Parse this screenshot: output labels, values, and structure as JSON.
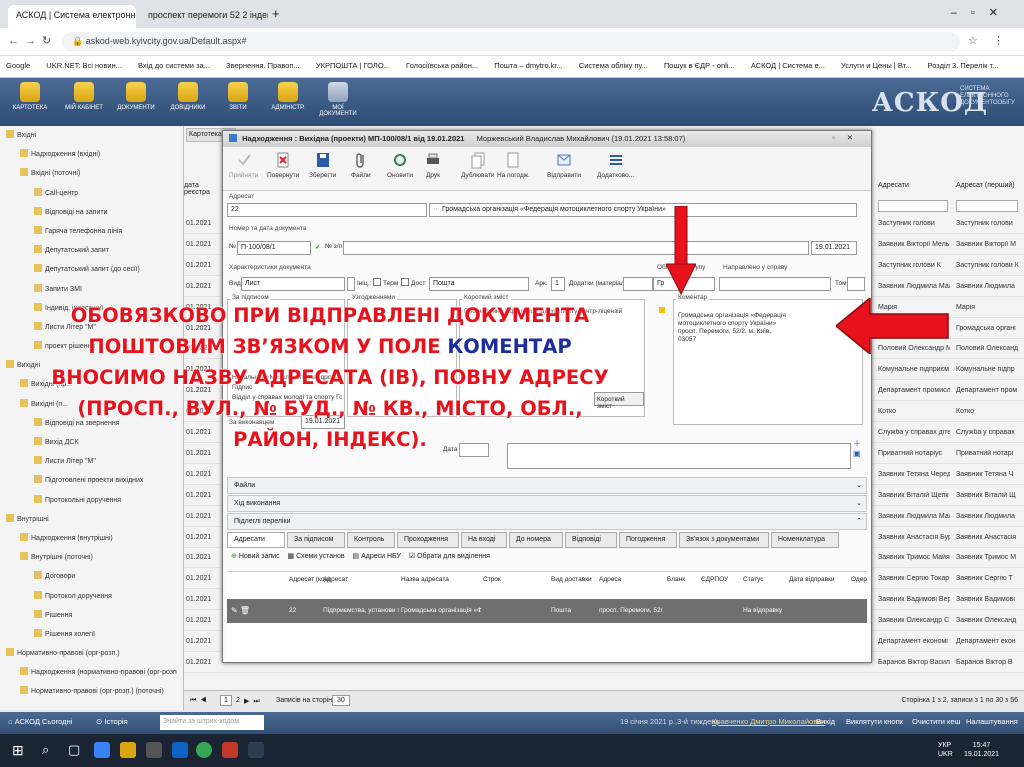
{
  "browser": {
    "tabs": [
      {
        "label": "АСКОД | Система електронног",
        "close": "✕"
      },
      {
        "label": "проспект перемоги 52 2 індекс",
        "close": "✕"
      }
    ],
    "new_tab": "+",
    "url": "askod-web.kyivcity.gov.ua/Default.aspx#",
    "bookmarks": [
      "Google",
      "UKR.NET: Всі новин...",
      "Вхід до системи за...",
      "Звернення. Правоп...",
      "УКРПОШТА | ГОЛО...",
      "Голосіївська район...",
      "Пошта – dmytro.kr...",
      "Система обліку пу...",
      "Пошук в ЄДР - onli...",
      "АСКОД | Система е...",
      "Услуги и Цены | Вт...",
      "Розділ 3. Перелік т..."
    ]
  },
  "app": {
    "toolbar": [
      "КАРТОТЕКА",
      "МІЙ КАБІНЕТ",
      "ДОКУМЕНТИ",
      "ДОВІДНИКИ",
      "ЗВІТИ",
      "АДМІНІСТР.",
      "МОЇ ДОКУМЕНТИ"
    ],
    "logo": "АСКОД",
    "logo_sub": "СИСТЕМА ЕЛЕКТРОННОГО ДОКУМЕНТООБІГУ"
  },
  "tree": [
    {
      "label": "Вхідні",
      "level": 0
    },
    {
      "label": "Надходження (вхідні)",
      "level": 1
    },
    {
      "label": "Вхідні (поточні)",
      "level": 1
    },
    {
      "label": "Call-центр",
      "level": 2
    },
    {
      "label": "Відповіді на запити",
      "level": 2
    },
    {
      "label": "Гаряча телефонна лінія",
      "level": 2
    },
    {
      "label": "Депутатський запит",
      "level": 2
    },
    {
      "label": "Депутатський запит (до сесії)",
      "level": 2
    },
    {
      "label": "Запити ЗМІ",
      "level": 2
    },
    {
      "label": "Індивід. інвестиції",
      "level": 2
    },
    {
      "label": "Листи Літер \"М\"",
      "level": 2
    },
    {
      "label": "проект рішення",
      "level": 2
    },
    {
      "label": "Вихідні",
      "level": 0
    },
    {
      "label": "Вихідні (пр...",
      "level": 1
    },
    {
      "label": "Вихідні (п...",
      "level": 1
    },
    {
      "label": "Відповіді на звернення",
      "level": 2
    },
    {
      "label": "Вихід ДСК",
      "level": 2
    },
    {
      "label": "Листи Літер \"М\"",
      "level": 2
    },
    {
      "label": "Підготовлені проекти вихідних",
      "level": 2
    },
    {
      "label": "Протокольні доручення",
      "level": 2
    },
    {
      "label": "Внутрішні",
      "level": 0
    },
    {
      "label": "Надходження (внутрішні)",
      "level": 1
    },
    {
      "label": "Внутрішні (поточні)",
      "level": 1
    },
    {
      "label": "Договори",
      "level": 2
    },
    {
      "label": "Протокол доручення",
      "level": 2
    },
    {
      "label": "Рішення",
      "level": 2
    },
    {
      "label": "Рішення колегії",
      "level": 2
    },
    {
      "label": "Нормативно-правові (орг-розп.)",
      "level": 0
    },
    {
      "label": "Надходження (нормативно-правові (орг-розп",
      "level": 1
    },
    {
      "label": "Нормативно-правові (орг-розп.) (поточні)",
      "level": 1
    }
  ],
  "bglist": {
    "tab": "Картотека",
    "col_left": "дата реєстра",
    "headers": [
      "Адресати",
      "Адресат (перший)"
    ],
    "dates": [
      "01.2021",
      "01.2021",
      "01.2021",
      "01.2021",
      "01.2021",
      "01.2021",
      "01.2021",
      "01.2021",
      "01.2021",
      "01.2021",
      "01.2021",
      "01.2021",
      "01.2021",
      "01.2021",
      "01.2021",
      "01.2021",
      "01.2021",
      "01.2021",
      "01.2021",
      "01.2021",
      "01.2021",
      "01.2021",
      "01.2021",
      "01.2021",
      "01.2021",
      "01.2021"
    ],
    "rows": [
      [
        "Заступник голови",
        "Заступник голови"
      ],
      [
        "Заявник Вікторії Мель",
        "Заявник Вікторії М"
      ],
      [
        "Заступник голови К",
        "Заступник голови К"
      ],
      [
        "Заявник Людмила Мал",
        "Заявник Людмила"
      ],
      [
        "Марія",
        "Марія"
      ],
      [
        "Громадська організац",
        "Громадська органі"
      ],
      [
        "Половий Олександр М",
        "Половий Олександ"
      ],
      [
        "Комунальне підприєм",
        "Комунальне підпр"
      ],
      [
        "Департамент промисл",
        "Департамент пром"
      ],
      [
        "Котко",
        "Котко"
      ],
      [
        "Служба у справах діте",
        "Служба у справах"
      ],
      [
        "Приватний нотаріус",
        "Приватний нотарі"
      ],
      [
        "Заявник Тетяна Черед",
        "Заявник Тетяна Ч"
      ],
      [
        "Заявник Віталій Щепк",
        "Заявник Віталій Щ"
      ],
      [
        "Заявник Людмила Мал",
        "Заявник Людмила"
      ],
      [
        "Заявник Анастасія Бур",
        "Заявник Анастасія"
      ],
      [
        "Заявник Тримос Майя",
        "Заявник Тримос М"
      ],
      [
        "Заявник Сергію Токар",
        "Заявник Сергію Т"
      ],
      [
        "Заявник Вадимові Вер",
        "Заявник Вадимові"
      ],
      [
        "Заявник Олександр С",
        "Заявник Олександ"
      ],
      [
        "Департамент економі",
        "Департамент екон"
      ],
      [
        "Баранов Віктор Васил",
        "Баранов Віктор В"
      ]
    ]
  },
  "modal": {
    "title": "Надходження : Вихідна (проекти) МП-100/08/1 від 19.01.2021",
    "title_extra": "Моржевський Владислав Михайлович (19.01.2021 13:58:07)",
    "toolbar": [
      "Прийняти",
      "Повернути",
      "Зберегти",
      "Файли",
      "Оновити",
      "Друк",
      "Дублювати",
      "На погодж.",
      "Відправити",
      "Додатково..."
    ],
    "addressee": {
      "label": "Адресат",
      "code": "22",
      "name": "Громадська організація «Федерація мотоциклетного спорту України»"
    },
    "number": {
      "label": "Номер та дата документа",
      "prefix": "№",
      "number": "П-100/08/1",
      "checkbox": "№ з/п",
      "date": "19.01.2021"
    },
    "doc_props": {
      "label": "Характеристики документа",
      "vid_label": "Вид",
      "vid": "Лист",
      "inic": "Ініц.:",
      "term": "Терм",
      "dost": "Дост",
      "dost_value": "Пошта",
      "ark": "Арк.",
      "ark_value": "1",
      "dodatky": "Додатки (матеріали)"
    },
    "restriction_label": "Обмеж. доступу",
    "restriction_value": "Гр",
    "sent_label": "Направлено у справу",
    "tom": "Том",
    "signer_label": "За підписом",
    "signer_value": "Начальнику Михали Олександрович",
    "agreed_label": "Узгодженнями",
    "summary_label": "Короткий зміст",
    "summary_text": "Про надання інформації щодо спорту контр-ліцензій",
    "signer2_label": "Підпис",
    "signer2": "Відділ у справах молоді та спорту Голосіївської р...",
    "executor_label": "За виконавцем",
    "executor_date": "19.01.2021",
    "short_button": "Короткий зміст",
    "comment_label": "Коментар",
    "comment_text": "Громадська організація «Федерація мотоциклетного спорту України» просп. Перемоги, 52/2, м. Київ, 03057",
    "date_label": "Дата",
    "sections": [
      "Файли",
      "Хід виконання",
      "Підлеглі переліки"
    ],
    "tabs": [
      "Адресати",
      "За підписом",
      "Контроль",
      "Проходження",
      "На вході",
      "До номера",
      "Відповіді",
      "Погодження",
      "Зв'язок з документами",
      "Номенклатура"
    ],
    "table_buttons": [
      "Новий запис",
      "Схеми установ",
      "Адреси НБУ",
      "Обрати для виділення"
    ],
    "table_headers": [
      "Адресат (код)",
      "Адресат",
      "Назва адресата",
      "Строк",
      "Вид доставки",
      "Адреса",
      "Бланк",
      "ЄДРПОУ",
      "Статус",
      "Дата відправки",
      "Одер"
    ],
    "table_row": [
      "22",
      "Підприємства, установи та",
      "Громадська організація «Ф",
      "",
      "Пошта",
      "просп. Перемоги, 52/",
      "",
      "",
      "На відправку",
      "",
      ""
    ]
  },
  "overlay": {
    "line1": "ОБОВЯЗКОВО ПРИ ВІДПРАВЛЕНІ ДОКУМЕНТА",
    "line2a": "ПОШТОВИМ ЗВ’ЯЗКОМ У ПОЛЕ ",
    "line2b": "КОМЕНТАР",
    "line3": "ВНОСИМО НАЗВУ АДРЕСАТА (ІВ), ПОВНУ АДРЕСУ",
    "line4": "(ПРОСП., ВУЛ., № БУД., № КВ., МІСТО, ОБЛ.,",
    "line5": "РАЙОН, ІНДЕКС)."
  },
  "pager": {
    "page": "1",
    "page2": "2",
    "per_page_label": "Записів на сторінці",
    "per_page": "30",
    "summary": "Сторінка 1 з 2, записи з 1 по 30 з 56"
  },
  "statusbar": {
    "left": "АСКОД Сьогодні",
    "history": "Історія",
    "search_placeholder": "Знайти за штрих-кодом",
    "date_info": "19 січня 2021 р.,3-й тиждень",
    "user": "Кравченко Дмитро Миколайович",
    "exit": "Вихід",
    "help": "Виклятути кнопк",
    "clear": "Очистити кеш",
    "settings": "Налаштування"
  },
  "taskbar": {
    "lang1": "УКР",
    "lang2": "UKR",
    "time": "15:47",
    "date": "19.01.2021"
  },
  "colors": {
    "accent_red": "#e8121c",
    "accent_blue": "#1e2ea0",
    "app_blue": "#2e4c74"
  }
}
